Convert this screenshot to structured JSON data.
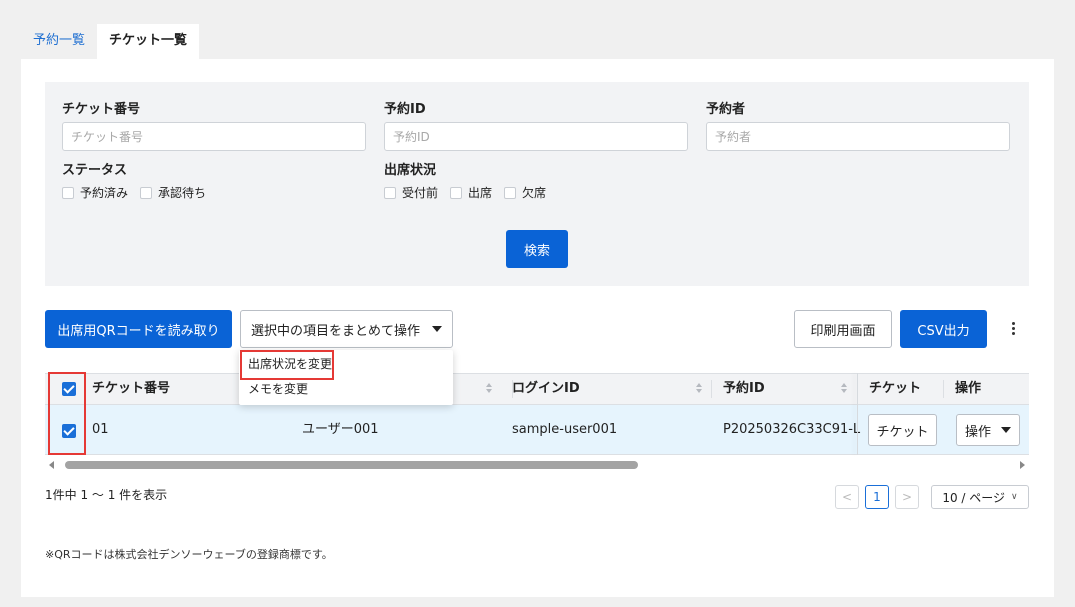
{
  "tabs": [
    {
      "label": "予約一覧",
      "active": false
    },
    {
      "label": "チケット一覧",
      "active": true
    }
  ],
  "filters": {
    "ticket_no": {
      "label": "チケット番号",
      "placeholder": "チケット番号"
    },
    "reservation_id": {
      "label": "予約ID",
      "placeholder": "予約ID"
    },
    "reserver": {
      "label": "予約者",
      "placeholder": "予約者"
    },
    "status": {
      "label": "ステータス",
      "options": [
        "予約済み",
        "承認待ち"
      ]
    },
    "attendance": {
      "label": "出席状況",
      "options": [
        "受付前",
        "出席",
        "欠席"
      ]
    },
    "search_label": "検索"
  },
  "toolbar": {
    "qr_label": "出席用QRコードを読み取り",
    "bulk_label": "選択中の項目をまとめて操作",
    "print_label": "印刷用画面",
    "csv_label": "CSV出力"
  },
  "dropdown": {
    "items": [
      "出席状況を変更",
      "メモを変更"
    ]
  },
  "table": {
    "columns": [
      "チケット番号",
      "ログインID",
      "予約ID",
      "チケット",
      "操作"
    ],
    "rows": [
      {
        "ticket_no": "01",
        "user": "ユーザー001",
        "login_id": "sample-user001",
        "reservation_id": "P20250326C33C91-L",
        "ticket_btn": "チケット",
        "action_btn": "操作"
      }
    ]
  },
  "pagination": {
    "summary": "1件中 1 〜 1 件を表示",
    "current_page": "1",
    "prev": "<",
    "next": ">",
    "page_size": "10 / ページ"
  },
  "footnote": "※QRコードは株式会社デンソーウェーブの登録商標です。",
  "colors": {
    "primary": "#0a63d6",
    "highlight": "#e53935",
    "selected_row": "#e6f4fd"
  }
}
